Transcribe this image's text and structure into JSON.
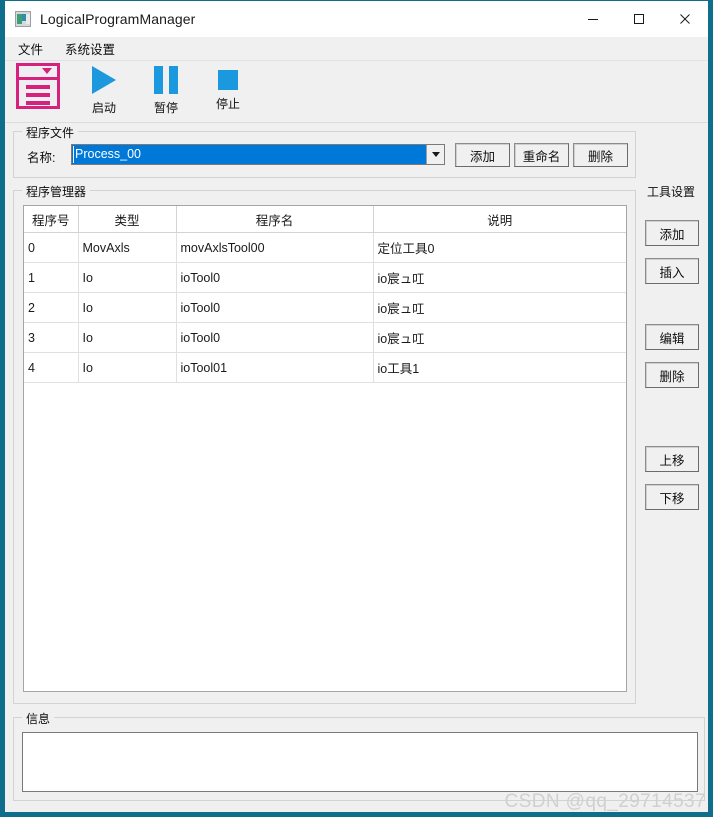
{
  "window": {
    "title": "LogicalProgramManager",
    "icon": "window-form-icon",
    "border_color": "#0e6e8c",
    "controls": {
      "minimize": "minimize-icon",
      "maximize": "maximize-icon",
      "close": "close-icon"
    }
  },
  "menubar": {
    "items": [
      {
        "label": "文件"
      },
      {
        "label": "系统设置"
      }
    ]
  },
  "toolbar": {
    "items": [
      {
        "label": "",
        "icon": "list-form-icon",
        "color": "#d6227d"
      },
      {
        "label": "启动",
        "icon": "play-icon",
        "color": "#1b98de"
      },
      {
        "label": "暂停",
        "icon": "pause-icon",
        "color": "#1b98de"
      },
      {
        "label": "停止",
        "icon": "stop-icon",
        "color": "#1b98de"
      }
    ]
  },
  "program_file": {
    "legend": "程序文件",
    "name_label": "名称:",
    "combo_value": "Process_00",
    "combo_selection_color": "#0078d7",
    "buttons": [
      {
        "label": "添加"
      },
      {
        "label": "重命名"
      },
      {
        "label": "删除"
      }
    ]
  },
  "program_manager": {
    "legend": "程序管理器",
    "columns": [
      "程序号",
      "类型",
      "程序名",
      "说明"
    ],
    "rows": [
      {
        "index": "0",
        "type": "MovAxls",
        "program": "movAxlsTool00",
        "description": "定位工具0"
      },
      {
        "index": "1",
        "type": "Io",
        "program": "ioTool0",
        "description": "io宸ュ叿"
      },
      {
        "index": "2",
        "type": "Io",
        "program": "ioTool0",
        "description": "io宸ュ叿"
      },
      {
        "index": "3",
        "type": "Io",
        "program": "ioTool0",
        "description": "io宸ュ叿"
      },
      {
        "index": "4",
        "type": "Io",
        "program": "ioTool01",
        "description": "io工具1"
      }
    ]
  },
  "tool_settings": {
    "legend": "工具设置",
    "buttons": [
      {
        "label": "添加"
      },
      {
        "label": "插入"
      },
      {
        "label": "编辑"
      },
      {
        "label": "删除"
      },
      {
        "label": "上移"
      },
      {
        "label": "下移"
      }
    ]
  },
  "info": {
    "legend": "信息",
    "content": ""
  },
  "watermark": {
    "text": "CSDN @qq_29714537"
  }
}
